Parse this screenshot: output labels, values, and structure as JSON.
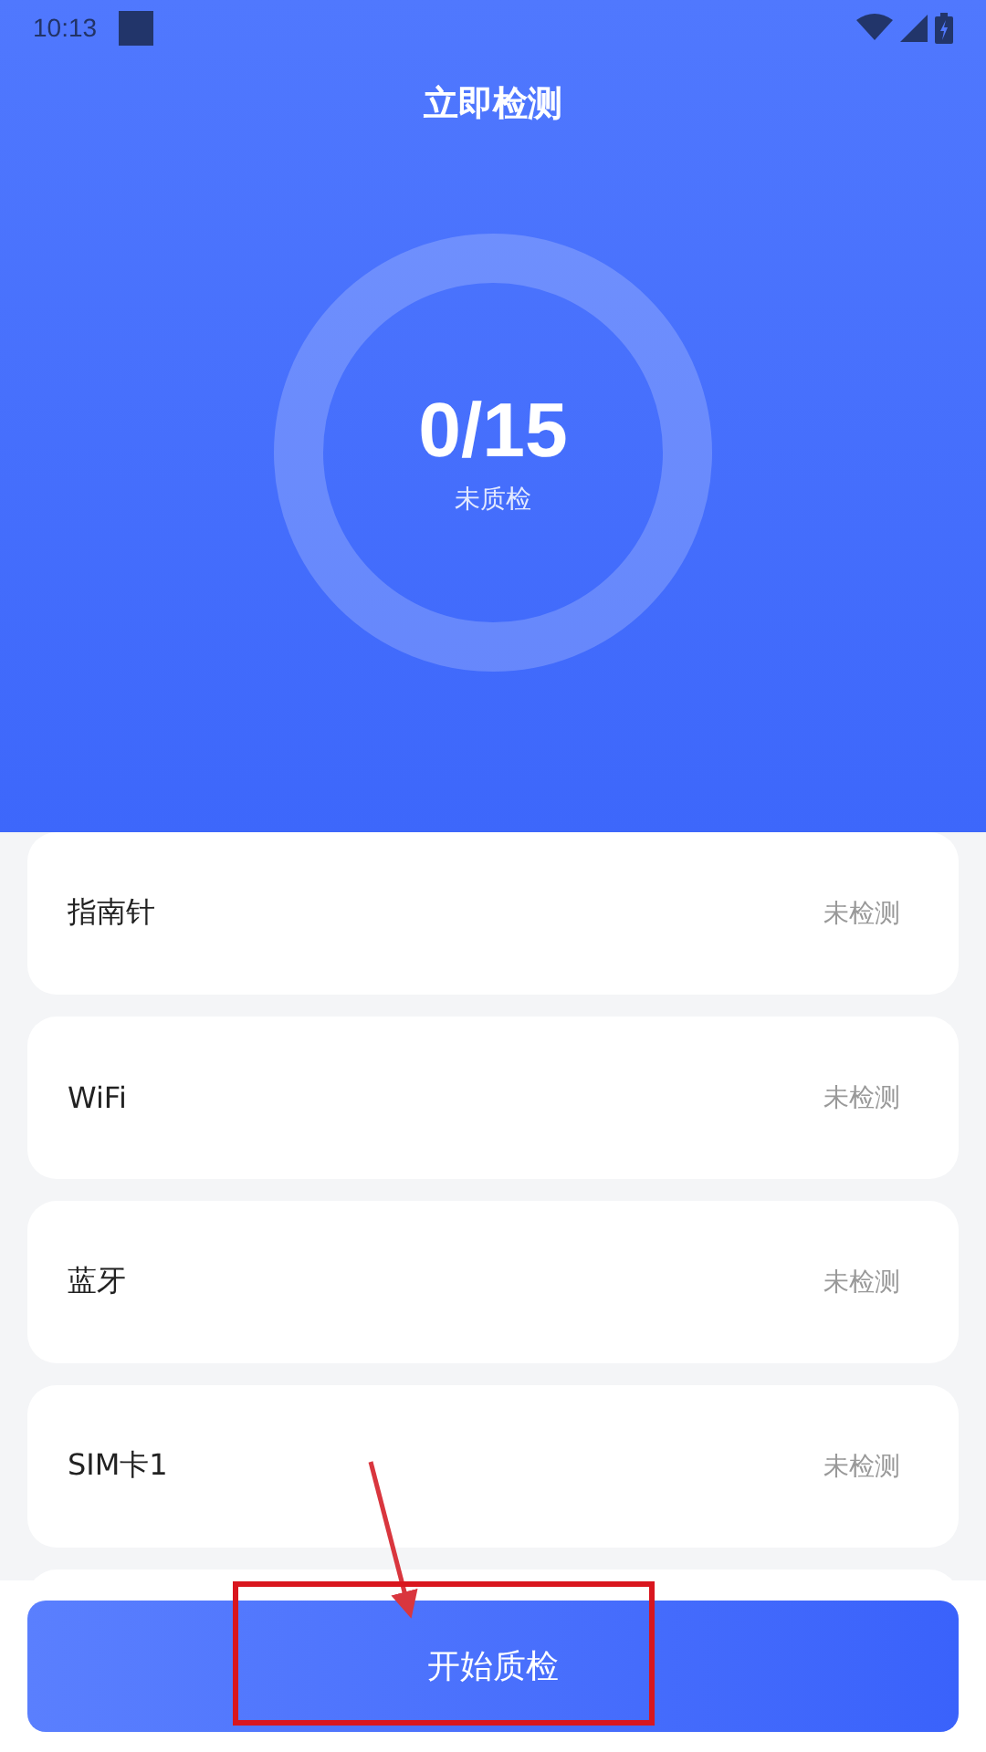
{
  "status_bar": {
    "time": "10:13"
  },
  "title": "立即检测",
  "summary": {
    "count": "0/15",
    "caption": "未质检"
  },
  "items": [
    {
      "name": "指南针",
      "status": "未检测"
    },
    {
      "name": "WiFi",
      "status": "未检测"
    },
    {
      "name": "蓝牙",
      "status": "未检测"
    },
    {
      "name": "SIM卡1",
      "status": "未检测"
    }
  ],
  "start_button": "开始质检"
}
